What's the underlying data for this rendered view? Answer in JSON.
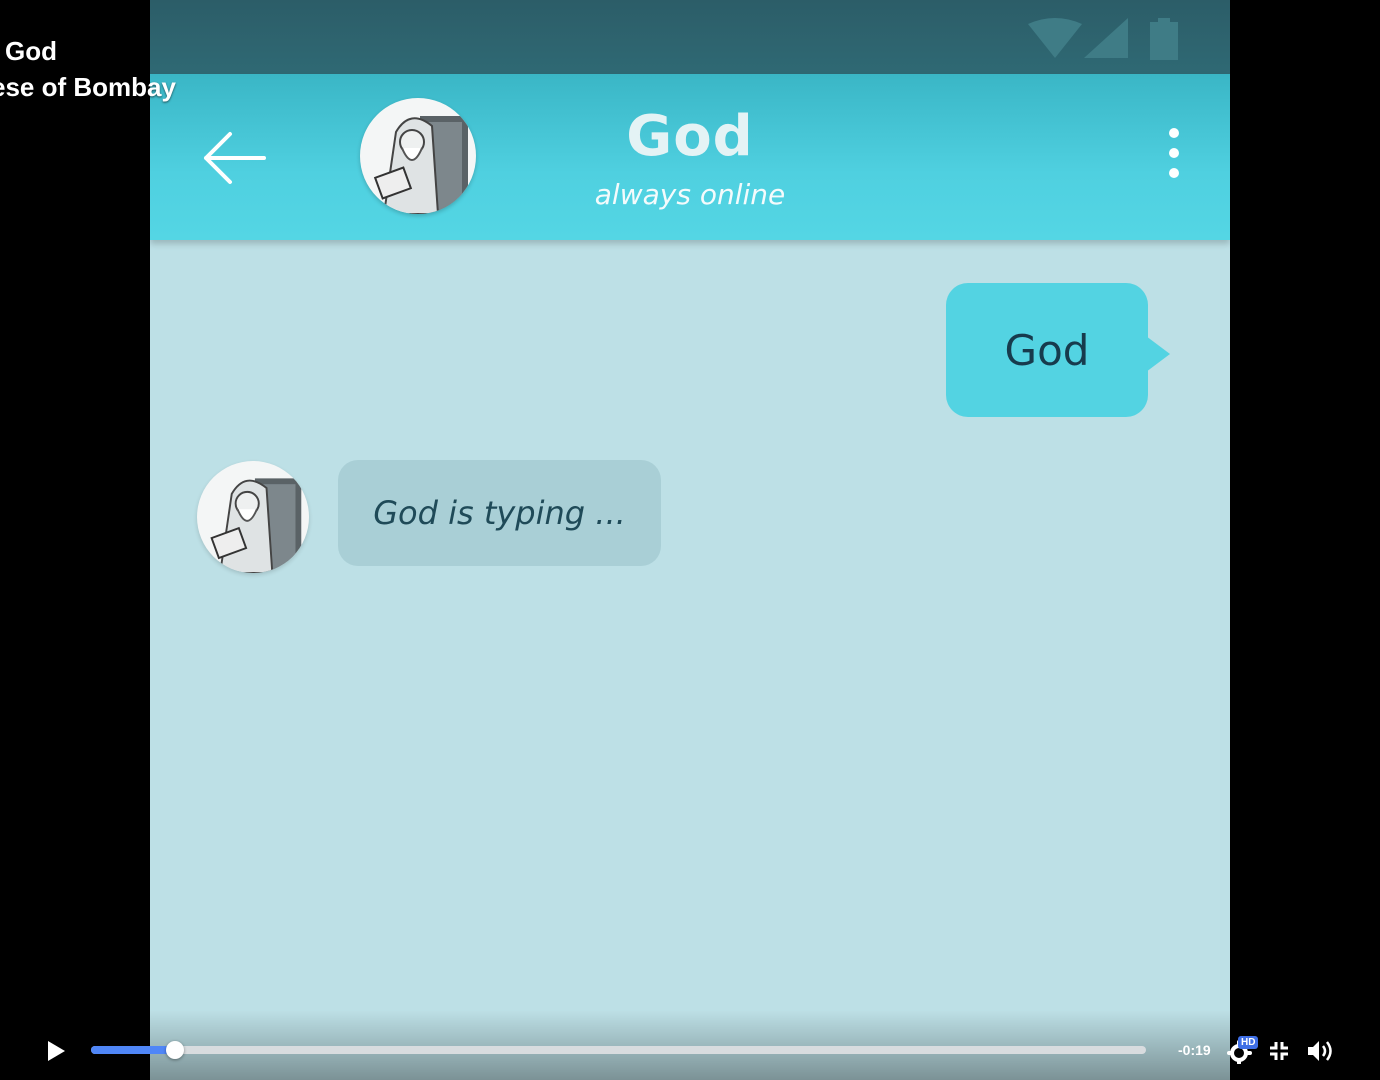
{
  "overlay": {
    "title": "God",
    "subtitle": "ese of Bombay"
  },
  "status_bar": {
    "icons": [
      "wifi-icon",
      "signal-icon",
      "battery-icon"
    ]
  },
  "chat_header": {
    "back_icon": "arrow-left-icon",
    "contact_name": "God",
    "contact_status": "always online",
    "menu_icon": "more-vertical-icon"
  },
  "messages": {
    "outgoing_text": "God",
    "incoming_text": "God is typing ..."
  },
  "player": {
    "progress": 0.08,
    "time_remaining": "-0:19",
    "quality_badge": "HD",
    "icons": [
      "play-icon",
      "settings-icon",
      "exit-fullscreen-icon",
      "volume-icon"
    ]
  },
  "colors": {
    "header": "#4fd0e0",
    "chat_background": "#bde0e6",
    "outgoing_bubble": "#53d3e2",
    "incoming_bubble": "#a9cfd6",
    "progress_fill": "#4f86f7"
  }
}
